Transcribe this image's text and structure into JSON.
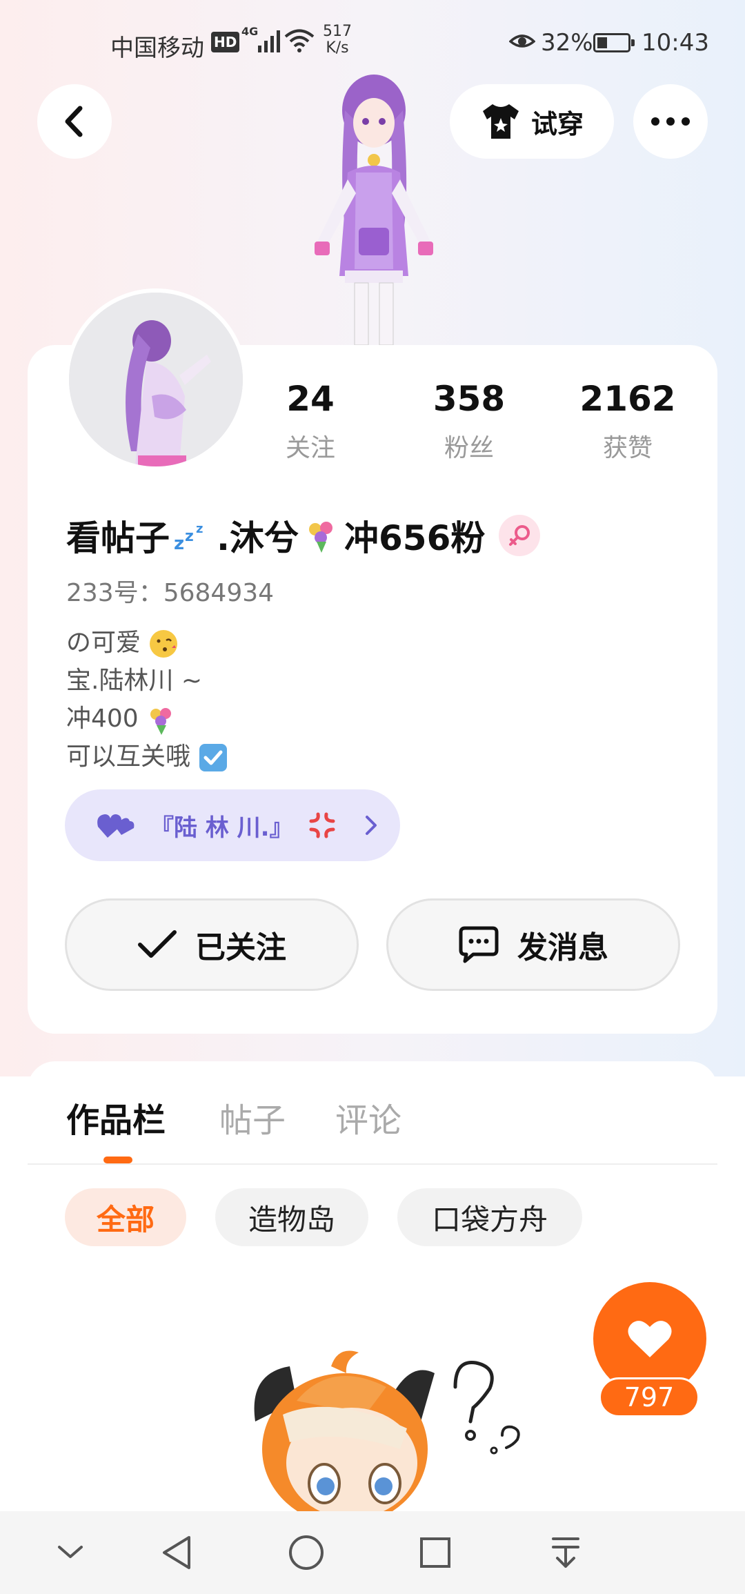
{
  "status_bar": {
    "carrier": "中国移动",
    "hd": "HD",
    "network": "4G",
    "speed_value": "517",
    "speed_unit": "K/s",
    "battery": "32%",
    "time": "10:43"
  },
  "header": {
    "try_on_label": "试穿"
  },
  "stats": [
    {
      "value": "24",
      "label": "关注"
    },
    {
      "value": "358",
      "label": "粉丝"
    },
    {
      "value": "2162",
      "label": "获赞"
    }
  ],
  "profile": {
    "nickname_part1": "看帖子",
    "nickname_part2": ".沐兮",
    "nickname_part3": "冲656粉",
    "uid": "233号：5684934",
    "bio": [
      "の可爱",
      "宝.陆林川 ~",
      "冲400",
      "可以互关哦"
    ]
  },
  "club": {
    "name": "『陆 林 川.』"
  },
  "actions": {
    "follow_label": "已关注",
    "message_label": "发消息"
  },
  "tabs": [
    "作品栏",
    "帖子",
    "评论"
  ],
  "chips": [
    "全部",
    "造物岛",
    "口袋方舟"
  ],
  "likes": {
    "count": "797"
  },
  "colors": {
    "accent": "#ff6a13",
    "club_text": "#6a5fd0",
    "gender_badge": "#fde3ea"
  }
}
